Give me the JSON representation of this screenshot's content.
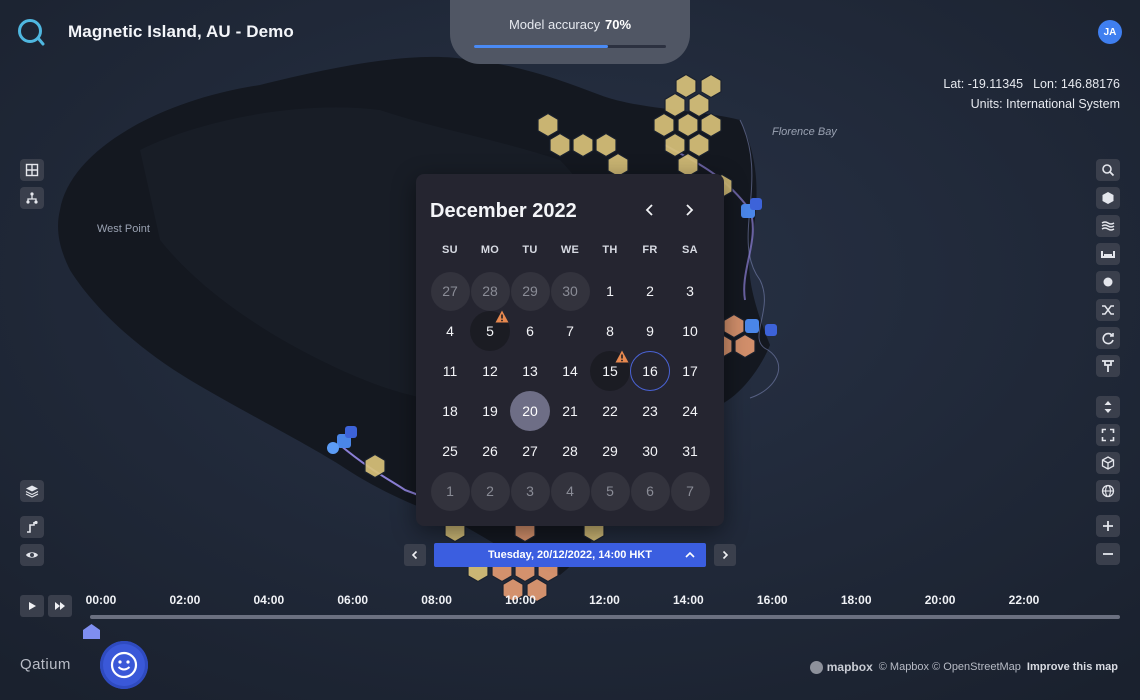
{
  "app": {
    "title": "Magnetic Island, AU - Demo",
    "avatar_initials": "JA",
    "brand": "Qatium"
  },
  "accuracy": {
    "label": "Model accuracy",
    "value": "70%",
    "fraction": 0.7
  },
  "coords": {
    "lat": "Lat: -19.11345",
    "lon": "Lon: 146.88176",
    "units": "Units: International System"
  },
  "map_labels": {
    "florence_bay": "Florence Bay",
    "west_point": "West Point"
  },
  "calendar": {
    "title": "December 2022",
    "weekdays": [
      "SU",
      "MO",
      "TU",
      "WE",
      "TH",
      "FR",
      "SA"
    ],
    "weeks": [
      [
        "27",
        "28",
        "29",
        "30",
        "1",
        "2",
        "3"
      ],
      [
        "4",
        "5",
        "6",
        "7",
        "8",
        "9",
        "10"
      ],
      [
        "11",
        "12",
        "13",
        "14",
        "15",
        "16",
        "17"
      ],
      [
        "18",
        "19",
        "20",
        "21",
        "22",
        "23",
        "24"
      ],
      [
        "25",
        "26",
        "27",
        "28",
        "29",
        "30",
        "31"
      ],
      [
        "1",
        "2",
        "3",
        "4",
        "5",
        "6",
        "7"
      ]
    ],
    "selected_day": "20",
    "today_day": "16",
    "alert_days": [
      "5",
      "15"
    ]
  },
  "date_bar": {
    "label": "Tuesday, 20/12/2022, 14:00 HKT"
  },
  "timeline": {
    "hours": [
      "00:00",
      "02:00",
      "04:00",
      "06:00",
      "08:00",
      "10:00",
      "12:00",
      "14:00",
      "16:00",
      "18:00",
      "20:00",
      "22:00"
    ],
    "position": 0
  },
  "attribution": {
    "mapbox": "mapbox",
    "copyright": "© Mapbox © OpenStreetMap",
    "improve": "Improve this map"
  },
  "colors": {
    "accent": "#3b5ee0",
    "hex_yellow": "#d9c27a",
    "hex_orange": "#e39a72",
    "warning": "#e8894f"
  },
  "left_tools": [
    "grid-icon",
    "network-icon",
    "layers-icon",
    "route-icon",
    "eye-icon"
  ],
  "right_tools": [
    "search-icon",
    "hexagon-icon",
    "waves-icon",
    "pipe-icon",
    "circle-icon",
    "shuffle-icon",
    "cycle-icon",
    "valve-icon",
    "sort-icon",
    "fullscreen-icon",
    "cube-icon",
    "globe-icon",
    "zoom-in-icon",
    "zoom-out-icon"
  ]
}
